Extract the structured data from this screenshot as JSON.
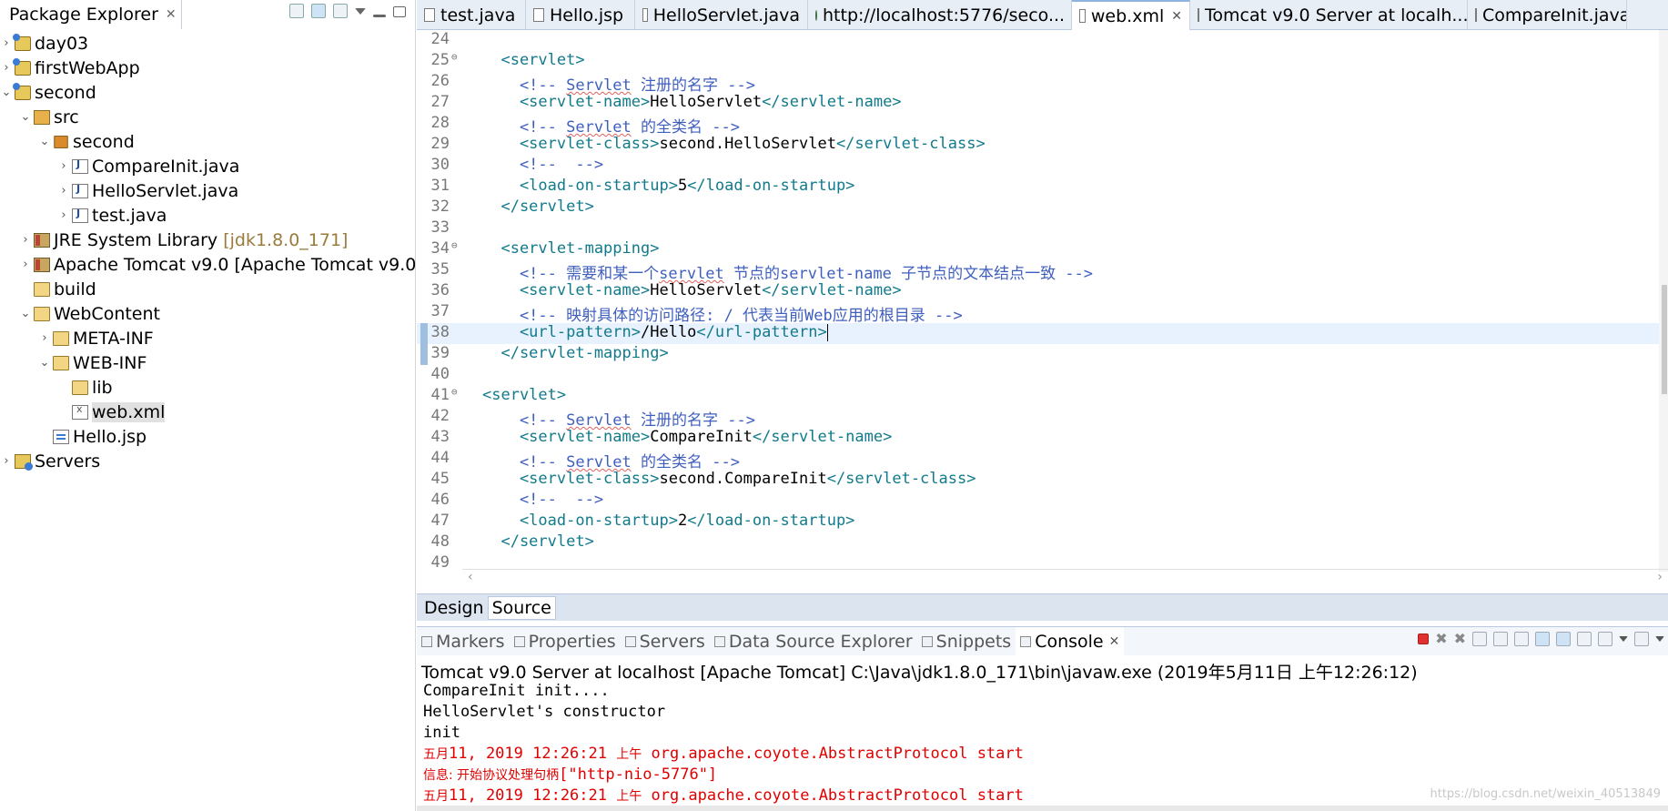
{
  "package_explorer": {
    "tab_label": "Package Explorer",
    "tab_close": "✕",
    "tree": [
      {
        "label": "day03",
        "twisty": "›",
        "icon": "proj",
        "level": 0
      },
      {
        "label": "firstWebApp",
        "twisty": "›",
        "icon": "proj",
        "level": 0
      },
      {
        "label": "second",
        "twisty": "⌄",
        "icon": "proj",
        "level": 0
      },
      {
        "label": "src",
        "twisty": "⌄",
        "icon": "srcf",
        "level": 1
      },
      {
        "label": "second",
        "twisty": "⌄",
        "icon": "pkg",
        "level": 2
      },
      {
        "label": "CompareInit.java",
        "twisty": "›",
        "icon": "java",
        "level": 3
      },
      {
        "label": "HelloServlet.java",
        "twisty": "›",
        "icon": "java",
        "level": 3
      },
      {
        "label": "test.java",
        "twisty": "›",
        "icon": "java",
        "level": 3
      },
      {
        "label": "JRE System Library",
        "deco": "[jdk1.8.0_171]",
        "twisty": "›",
        "icon": "lib",
        "level": 1
      },
      {
        "label": "Apache Tomcat v9.0 [Apache Tomcat v9.0]",
        "twisty": "›",
        "icon": "lib",
        "level": 1
      },
      {
        "label": "build",
        "twisty": "",
        "icon": "folder",
        "level": 1
      },
      {
        "label": "WebContent",
        "twisty": "⌄",
        "icon": "folder",
        "level": 1
      },
      {
        "label": "META-INF",
        "twisty": "›",
        "icon": "folder",
        "level": 2
      },
      {
        "label": "WEB-INF",
        "twisty": "⌄",
        "icon": "folder",
        "level": 2
      },
      {
        "label": "lib",
        "twisty": "",
        "icon": "folder",
        "level": 3
      },
      {
        "label": "web.xml",
        "twisty": "",
        "icon": "xml",
        "level": 3,
        "selected": true
      },
      {
        "label": "Hello.jsp",
        "twisty": "",
        "icon": "jsp",
        "level": 2
      },
      {
        "label": "Servers",
        "twisty": "›",
        "icon": "server",
        "level": 0
      }
    ]
  },
  "editor": {
    "tabs": [
      {
        "label": "test.java",
        "icon": "doc",
        "active": false
      },
      {
        "label": "Hello.jsp",
        "icon": "doc",
        "active": false
      },
      {
        "label": "HelloServlet.java",
        "icon": "doc",
        "active": false
      },
      {
        "label": "http://localhost:5776/seco...",
        "icon": "globe",
        "active": false
      },
      {
        "label": "web.xml",
        "icon": "doc",
        "active": true,
        "close": "✕"
      },
      {
        "label": "Tomcat v9.0 Server at localh...",
        "icon": "doc",
        "active": false
      },
      {
        "label": "CompareInit.java",
        "icon": "doc",
        "active": false
      }
    ],
    "lines": [
      {
        "n": "24",
        "segs": []
      },
      {
        "n": "25",
        "fold": true,
        "segs": [
          [
            "tag",
            "  <servlet>"
          ]
        ]
      },
      {
        "n": "26",
        "segs": [
          [
            "cmt",
            "    <!-- "
          ],
          [
            "cmtsq",
            "Servlet"
          ],
          [
            "cmt",
            " 注册的名字 -->"
          ]
        ]
      },
      {
        "n": "27",
        "segs": [
          [
            "tag",
            "    <servlet-name>"
          ],
          [
            "txt",
            "HelloServlet"
          ],
          [
            "tag",
            "</servlet-name>"
          ]
        ]
      },
      {
        "n": "28",
        "segs": [
          [
            "cmt",
            "    <!-- "
          ],
          [
            "cmtsq",
            "Servlet"
          ],
          [
            "cmt",
            " 的全类名 -->"
          ]
        ]
      },
      {
        "n": "29",
        "segs": [
          [
            "tag",
            "    <servlet-class>"
          ],
          [
            "txt",
            "second.HelloServlet"
          ],
          [
            "tag",
            "</servlet-class>"
          ]
        ]
      },
      {
        "n": "30",
        "segs": [
          [
            "cmt",
            "    <!--  -->"
          ]
        ]
      },
      {
        "n": "31",
        "segs": [
          [
            "tag",
            "    <load-on-startup>"
          ],
          [
            "txt",
            "5"
          ],
          [
            "tag",
            "</load-on-startup>"
          ]
        ]
      },
      {
        "n": "32",
        "segs": [
          [
            "tag",
            "  </servlet>"
          ]
        ]
      },
      {
        "n": "33",
        "segs": []
      },
      {
        "n": "34",
        "fold": true,
        "segs": [
          [
            "tag",
            "  <servlet-mapping>"
          ]
        ]
      },
      {
        "n": "35",
        "segs": [
          [
            "cmt",
            "    <!-- 需要和某一个"
          ],
          [
            "cmtsq",
            "servlet"
          ],
          [
            "cmt",
            " 节点的servlet-name 子节点的文本结点一致 -->"
          ]
        ]
      },
      {
        "n": "36",
        "segs": [
          [
            "tag",
            "    <servlet-name>"
          ],
          [
            "txt",
            "HelloServlet"
          ],
          [
            "tag",
            "</servlet-name>"
          ]
        ]
      },
      {
        "n": "37",
        "segs": [
          [
            "cmt",
            "    <!-- 映射具体的访问路径: / 代表当前Web应用的根目录 -->"
          ]
        ]
      },
      {
        "n": "38",
        "cur": true,
        "marker": true,
        "segs": [
          [
            "tag",
            "    <url-pattern>"
          ],
          [
            "txt",
            "/Hello"
          ],
          [
            "tag",
            "</url-pattern>"
          ],
          [
            "caret",
            ""
          ]
        ]
      },
      {
        "n": "39",
        "marker": true,
        "segs": [
          [
            "tag",
            "  </servlet-mapping>"
          ]
        ]
      },
      {
        "n": "40",
        "segs": []
      },
      {
        "n": "41",
        "fold": true,
        "segs": [
          [
            "tag",
            "<servlet>"
          ]
        ]
      },
      {
        "n": "42",
        "segs": [
          [
            "cmt",
            "    <!-- "
          ],
          [
            "cmtsq",
            "Servlet"
          ],
          [
            "cmt",
            " 注册的名字 -->"
          ]
        ]
      },
      {
        "n": "43",
        "segs": [
          [
            "tag",
            "    <servlet-name>"
          ],
          [
            "txt",
            "CompareInit"
          ],
          [
            "tag",
            "</servlet-name>"
          ]
        ]
      },
      {
        "n": "44",
        "segs": [
          [
            "cmt",
            "    <!-- "
          ],
          [
            "cmtsq",
            "Servlet"
          ],
          [
            "cmt",
            " 的全类名 -->"
          ]
        ]
      },
      {
        "n": "45",
        "segs": [
          [
            "tag",
            "    <servlet-class>"
          ],
          [
            "txt",
            "second.CompareInit"
          ],
          [
            "tag",
            "</servlet-class>"
          ]
        ]
      },
      {
        "n": "46",
        "segs": [
          [
            "cmt",
            "    <!--  -->"
          ]
        ]
      },
      {
        "n": "47",
        "segs": [
          [
            "tag",
            "    <load-on-startup>"
          ],
          [
            "txt",
            "2"
          ],
          [
            "tag",
            "</load-on-startup>"
          ]
        ]
      },
      {
        "n": "48",
        "segs": [
          [
            "tag",
            "  </servlet>"
          ]
        ]
      },
      {
        "n": "49",
        "segs": []
      }
    ],
    "subtabs": [
      {
        "label": "Design",
        "active": false
      },
      {
        "label": "Source",
        "active": true
      }
    ]
  },
  "bottom_panel": {
    "tabs": [
      {
        "label": "Markers",
        "active": false
      },
      {
        "label": "Properties",
        "active": false
      },
      {
        "label": "Servers",
        "active": false
      },
      {
        "label": "Data Source Explorer",
        "active": false
      },
      {
        "label": "Snippets",
        "active": false
      },
      {
        "label": "Console",
        "active": true,
        "close": "✕"
      }
    ],
    "console_description": "Tomcat v9.0 Server at localhost [Apache Tomcat] C:\\Java\\jdk1.8.0_171\\bin\\javaw.exe (2019年5月11日 上午12:26:12)",
    "output": [
      {
        "kind": "out",
        "parts": [
          [
            "m",
            "CompareInit init...."
          ]
        ]
      },
      {
        "kind": "out",
        "parts": [
          [
            "m",
            "HelloServlet's constructor"
          ]
        ]
      },
      {
        "kind": "out",
        "parts": [
          [
            "m",
            "init"
          ]
        ]
      },
      {
        "kind": "err",
        "parts": [
          [
            "cn",
            "五月"
          ],
          [
            "m",
            "11, 2019 12:26:21 "
          ],
          [
            "cn",
            "上午"
          ],
          [
            "m",
            " org.apache.coyote.AbstractProtocol start"
          ]
        ]
      },
      {
        "kind": "err",
        "parts": [
          [
            "cn",
            "信息: 开始协议处理句柄"
          ],
          [
            "m",
            "[\"http-nio-5776\"]"
          ]
        ]
      },
      {
        "kind": "err",
        "parts": [
          [
            "cn",
            "五月"
          ],
          [
            "m",
            "11, 2019 12:26:21 "
          ],
          [
            "cn",
            "上午"
          ],
          [
            "m",
            " org.apache.coyote.AbstractProtocol start"
          ]
        ]
      }
    ],
    "watermark": "https://blog.csdn.net/weixin_40513849"
  }
}
